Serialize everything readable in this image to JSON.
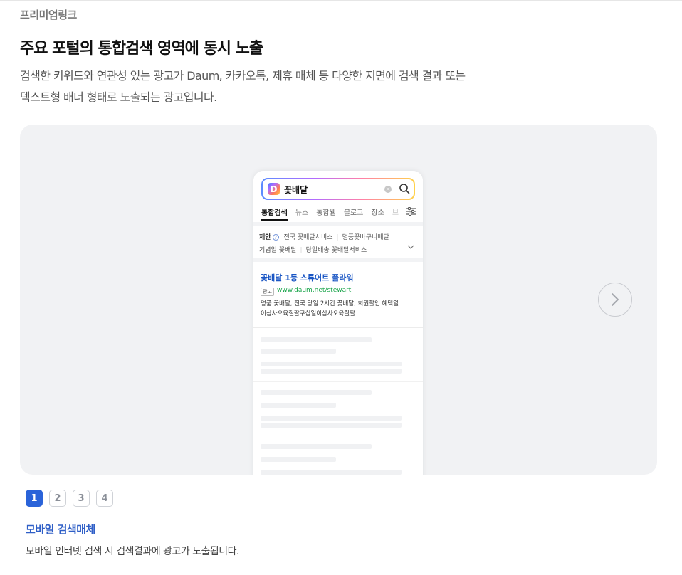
{
  "section": {
    "eyebrow": "프리미엄링크",
    "headline": "주요 포털의 통합검색 영역에 동시 노출",
    "description_line1": "검색한 키워드와 연관성 있는 광고가 Daum, 카카오톡, 제휴 매체 등 다양한 지면에 검색 결과 또는",
    "description_line2": "텍스트형 배너 형태로 노출되는 광고입니다."
  },
  "phone": {
    "logo_letter": "D",
    "search_query": "꽃배달",
    "clear_glyph": "×",
    "tabs": [
      "통합검색",
      "뉴스",
      "통합웹",
      "블로그",
      "장소",
      "브"
    ],
    "suggest": {
      "lead": "제안",
      "help_glyph": "?",
      "row1": [
        "전국 꽃배달서비스",
        "명품꽃바구니배달"
      ],
      "row2": [
        "기념일 꽃배달",
        "당일배송 꽃배달서비스"
      ]
    },
    "ad": {
      "title": "꽃배달 1등 스튜어트 플라워",
      "badge": "광고",
      "url": "www.daum.net/stewart",
      "body_line1": "명품 꽃배달, 전국 당일 2시간 꽃배달, 회원할인 혜택일",
      "body_line2": "이삼사오육칠팔구십일이삼사오육칠팔"
    }
  },
  "pager": {
    "pages": [
      "1",
      "2",
      "3",
      "4"
    ],
    "current": "1"
  },
  "caption": {
    "title": "모바일 검색매체",
    "description": "모바일 인터넷 검색 시 검색결과에 광고가 노출됩니다."
  },
  "colors": {
    "accent": "#2a63d9",
    "caption_title": "#2f5fc7",
    "ad_title": "#1a56c4",
    "ad_url": "#19a44a",
    "stage_bg": "#f1f2f4"
  },
  "icons": {
    "next": "chevron-right-icon",
    "search": "search-icon",
    "clear": "clear-icon",
    "filter": "filter-icon",
    "expand": "chevron-down-icon",
    "help": "help-icon"
  }
}
